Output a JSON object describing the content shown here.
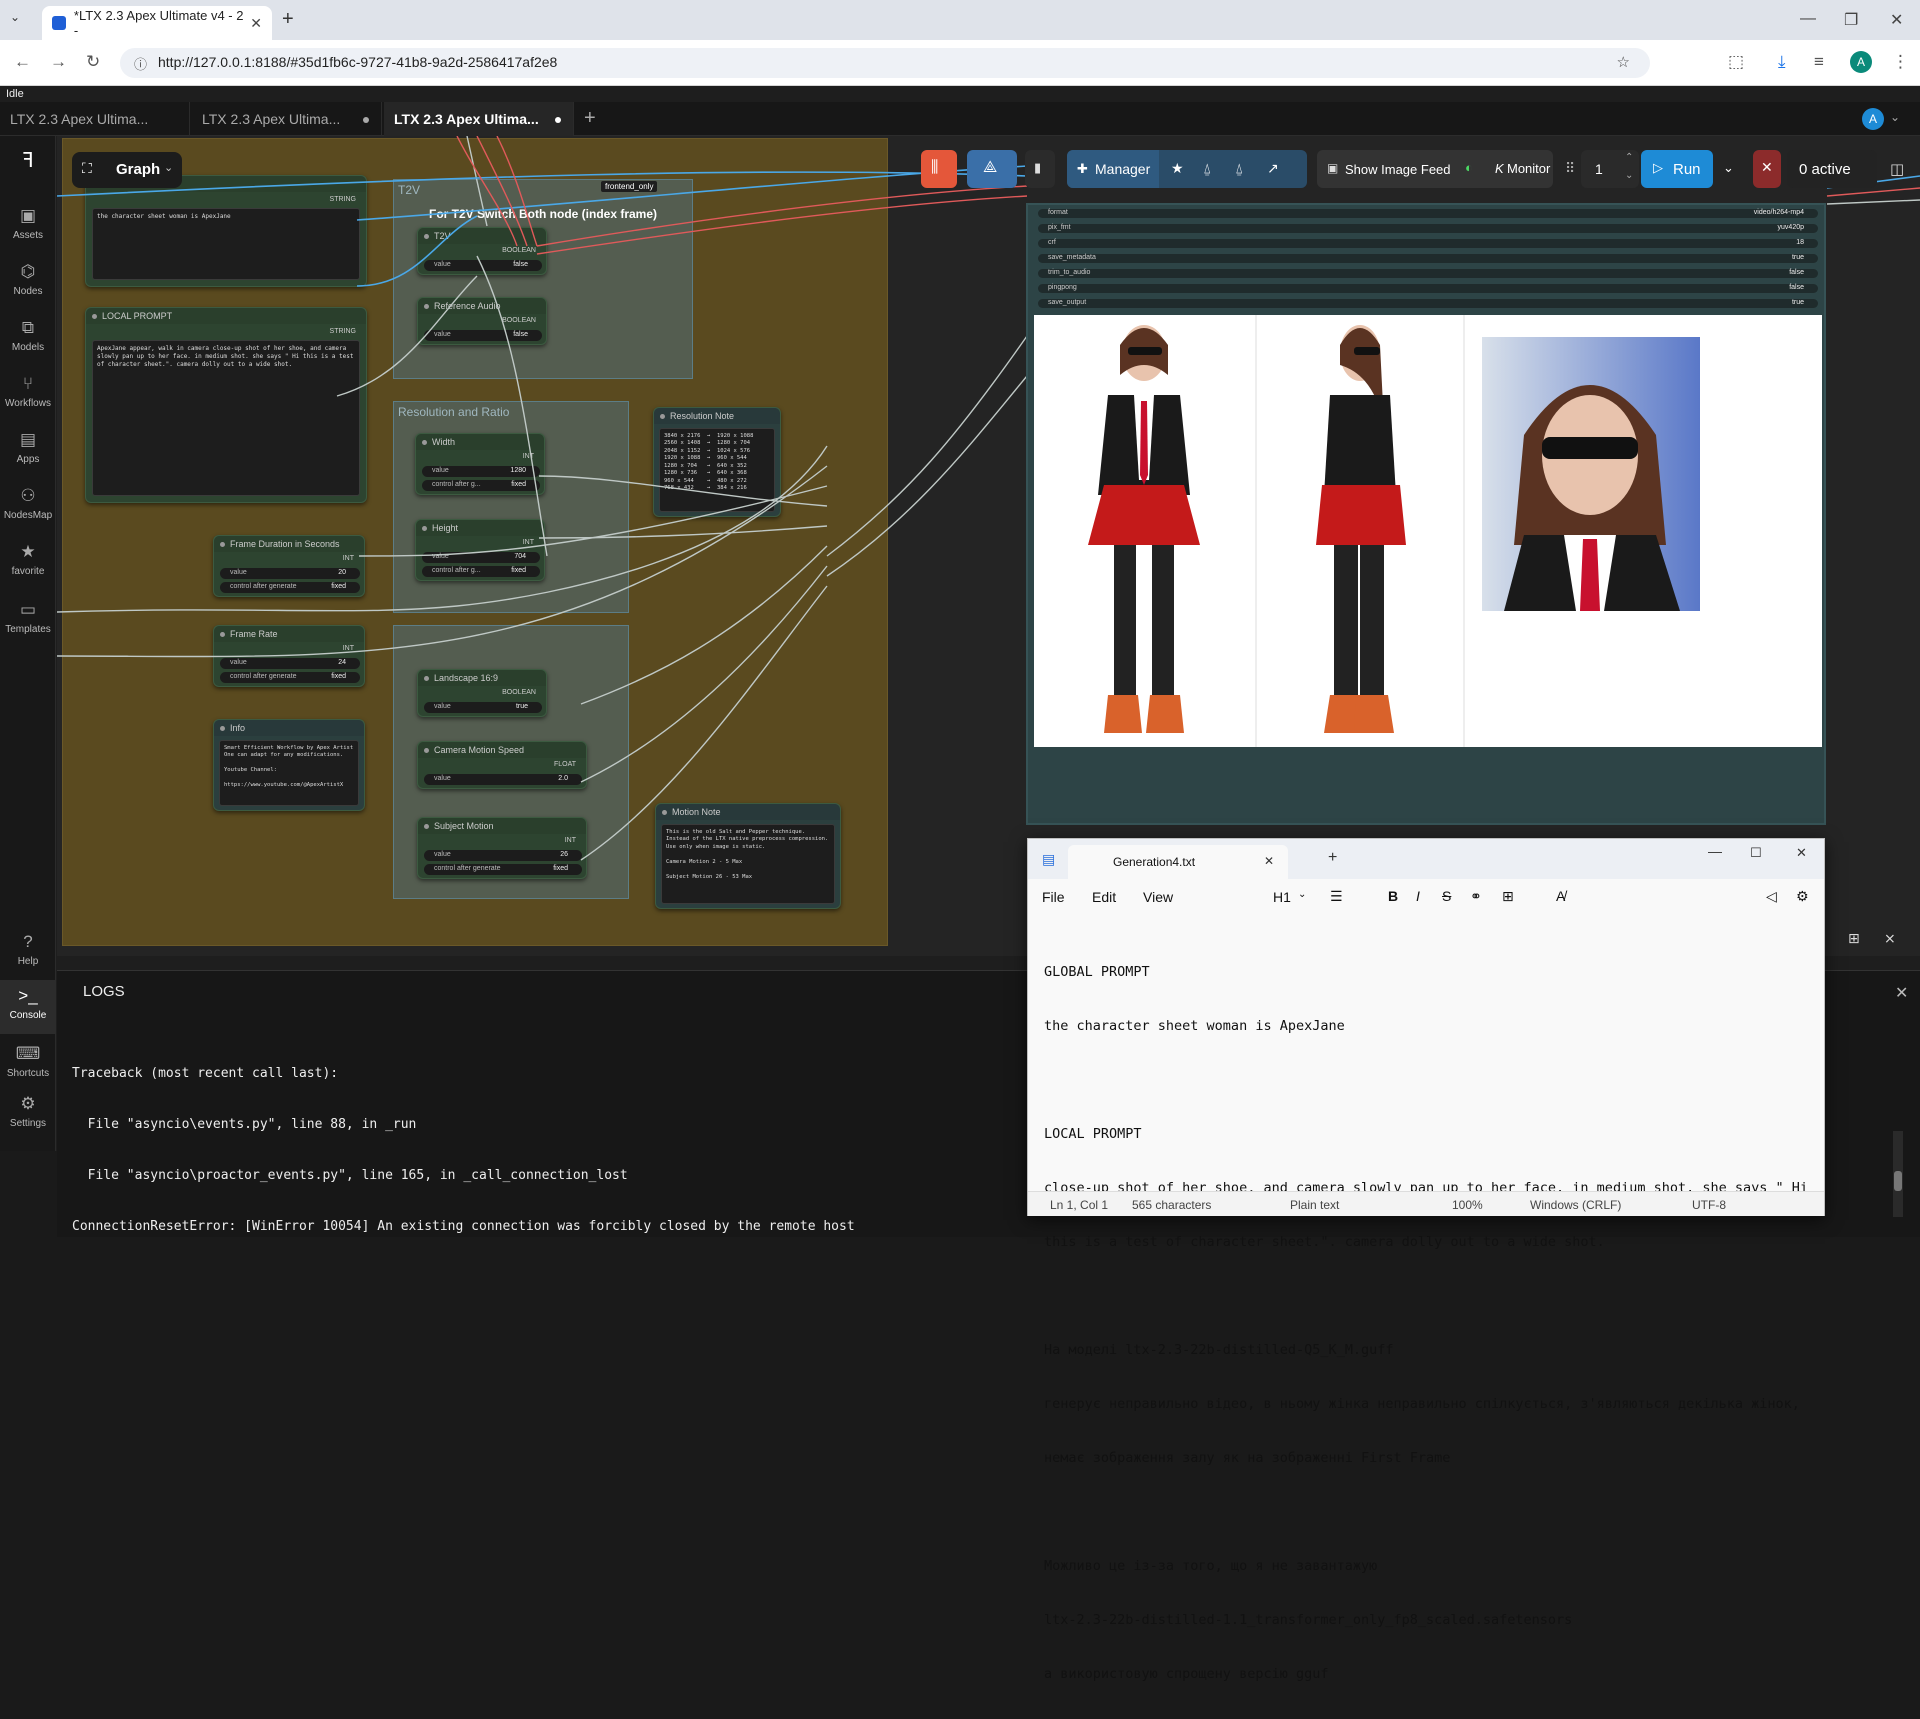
{
  "browser": {
    "tab_title": "*LTX 2.3 Apex Ultimate v4 - 2 -",
    "new_tab": "+",
    "url": "http://127.0.0.1:8188/#35d1fb6c-9727-41b8-9a2d-2586417af2e8",
    "profile_initial": "A"
  },
  "app": {
    "status": "Idle",
    "workflow_tabs": [
      {
        "label": "LTX 2.3 Apex Ultima...",
        "active": false
      },
      {
        "label": "LTX 2.3 Apex Ultima...",
        "active": false
      },
      {
        "label": "LTX 2.3 Apex Ultima...",
        "active": true
      }
    ],
    "add_tab": "+",
    "user_initial": "A",
    "graph_label": "Graph",
    "sidebar": [
      "Assets",
      "Nodes",
      "Models",
      "Workflows",
      "Apps",
      "NodesMap",
      "favorite",
      "Templates"
    ],
    "sidebar_bottom": [
      "Help",
      "Console",
      "Shortcuts",
      "Settings"
    ]
  },
  "toolbar": {
    "manager": "Manager",
    "show_image_feed": "Show Image Feed",
    "monitor": "Monitor",
    "queue_count": "1",
    "run": "Run",
    "active": "0 active"
  },
  "nodes": {
    "global_prompt": {
      "title": "GLOBAL PROMPT",
      "type": "STRING",
      "text": "the character sheet woman is ApexJane"
    },
    "local_prompt": {
      "title": "LOCAL PROMPT",
      "type": "STRING",
      "text": "ApexJane appear, walk in camera close-up shot of her shoe, and camera slowly pan up to her face. in medium shot. she says \" Hi this is a test of character sheet.\". camera dolly out to a wide shot."
    },
    "t2v_group": "T2V",
    "t2v_note": "For T2V Switch Both node (index frame)",
    "frontend_only": "frontend_only",
    "t2v": {
      "title": "T2V",
      "type": "BOOLEAN",
      "widget": "value",
      "value": "false"
    },
    "ref_audio": {
      "title": "Reference Audio",
      "type": "BOOLEAN",
      "widget": "value",
      "value": "false"
    },
    "res_group": "Resolution and Ratio",
    "width": {
      "title": "Width",
      "type": "INT",
      "value": "1280",
      "ctrl": "control after g...",
      "ctrl_val": "fixed"
    },
    "height": {
      "title": "Height",
      "type": "INT",
      "value": "704",
      "ctrl": "control after g...",
      "ctrl_val": "fixed"
    },
    "res_note": {
      "title": "Resolution Note",
      "text": "3840 x 2176  →  1920 x 1088\n2560 x 1408  →  1280 x 704\n2048 x 1152  →  1024 x 576\n1920 x 1088  →  960 x 544\n1280 x 704   →  640 x 352\n1280 x 736   →  640 x 368\n960 x 544    →  480 x 272\n768 x 432    →  384 x 216"
    },
    "frame_duration": {
      "title": "Frame Duration in Seconds",
      "type": "INT",
      "value": "20",
      "ctrl": "control after generate",
      "ctrl_val": "fixed"
    },
    "frame_rate": {
      "title": "Frame Rate",
      "type": "INT",
      "value": "24",
      "ctrl": "control after generate",
      "ctrl_val": "fixed"
    },
    "landscape": {
      "title": "Landscape 16:9",
      "type": "BOOLEAN",
      "widget": "value",
      "value": "true"
    },
    "camera_speed": {
      "title": "Camera Motion Speed",
      "type": "FLOAT",
      "widget": "value",
      "value": "2.0"
    },
    "subject_motion": {
      "title": "Subject Motion",
      "type": "INT",
      "value": "26",
      "ctrl": "control after generate",
      "ctrl_val": "fixed"
    },
    "info": {
      "title": "Info",
      "text": "Smart Efficient Workflow by Apex Artist\nOne can adapt for any modifications.\n\nYoutube Channel:\n\nhttps://www.youtube.com/@ApexArtistX"
    },
    "motion_note": {
      "title": "Motion Note",
      "text": "This is the old Salt and Pepper technique.\nInstead of the LTX native preprocess compression.\nUse only when image is static.\n\nCamera Motion 2 - 5 Max\n\nSubject Motion 26 - 53 Max"
    }
  },
  "output_node": {
    "rows": [
      {
        "label": "format",
        "value": "video/h264-mp4"
      },
      {
        "label": "pix_fmt",
        "value": "yuv420p"
      },
      {
        "label": "crf",
        "value": "18"
      },
      {
        "label": "save_metadata",
        "value": "true"
      },
      {
        "label": "trim_to_audio",
        "value": "false"
      },
      {
        "label": "pingpong",
        "value": "false"
      },
      {
        "label": "save_output",
        "value": "true"
      }
    ]
  },
  "notepad": {
    "filename": "Generation4.txt",
    "menu": [
      "File",
      "Edit",
      "View"
    ],
    "heading": "H1",
    "lines": [
      "GLOBAL PROMPT",
      "the character sheet woman is ApexJane",
      "",
      "LOCAL PROMPT",
      "close-up shot of her shoe, and camera slowly pan up to her face. in medium shot. she says \" Hi",
      "this is a test of character sheet.\". camera dolly out to a wide shot.",
      "",
      "На моделі ltx-2.3-22b-distilled-Q5_K_M.guff",
      "генерує неправильно відео, в ньому жінка неправильно спілкується, з'являються декілька жінок,",
      "немає зображення залу як на зображенні First Frame",
      "",
      "Можливо це із-за того, що я не завантажую",
      "ltx-2.3-22b-distilled-1.1_transformer_only_fp8_scaled.safetensors",
      "а використовую спрощену версію gguf"
    ],
    "status": {
      "pos": "Ln 1, Col 1",
      "chars": "565 characters",
      "format": "Plain text",
      "zoom": "100%",
      "eol": "Windows (CRLF)",
      "enc": "UTF-8"
    }
  },
  "logs": {
    "title": "LOGS",
    "lines": [
      "Traceback (most recent call last):",
      "  File \"asyncio\\events.py\", line 88, in _run",
      "  File \"asyncio\\proactor_events.py\", line 165, in _call_connection_lost",
      "ConnectionResetError: [WinError 10054] An existing connection was forcibly closed by the remote host"
    ]
  }
}
